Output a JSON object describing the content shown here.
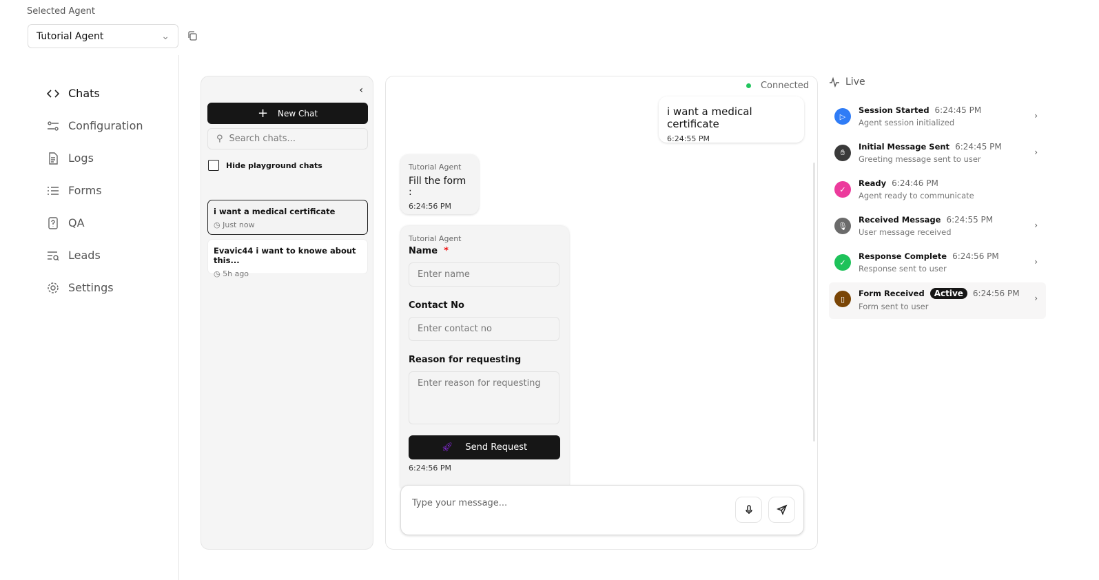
{
  "agent": {
    "label": "Selected Agent",
    "selected": "Tutorial Agent"
  },
  "nav": [
    {
      "label": "Chats",
      "icon": "code-icon"
    },
    {
      "label": "Configuration",
      "icon": "sliders-icon"
    },
    {
      "label": "Logs",
      "icon": "file-icon"
    },
    {
      "label": "Forms",
      "icon": "list-icon"
    },
    {
      "label": "QA",
      "icon": "help-icon"
    },
    {
      "label": "Leads",
      "icon": "filter-search-icon"
    },
    {
      "label": "Settings",
      "icon": "gear-icon"
    }
  ],
  "chat_list": {
    "new_chat": "New Chat",
    "search_placeholder": "Search chats...",
    "hide_label": "Hide playground chats",
    "items": [
      {
        "title": "i want a medical certificate",
        "time": "Just now"
      },
      {
        "title": "Evavic44 i want to knowe about this...",
        "time": "5h ago"
      }
    ]
  },
  "chat": {
    "status": "Connected",
    "user_msg": {
      "text": "i want a medical certificate",
      "time": "6:24:55 PM"
    },
    "agent_msg": {
      "sender": "Tutorial Agent",
      "text": "Fill the form :",
      "time": "6:24:56 PM"
    },
    "form": {
      "sender": "Tutorial Agent",
      "fields": [
        {
          "label": "Name",
          "required": "*",
          "placeholder": "Enter name"
        },
        {
          "label": "Contact No",
          "placeholder": "Enter contact no"
        },
        {
          "label": "Reason for requesting",
          "placeholder": "Enter reason for requesting"
        }
      ],
      "submit": "Send Request",
      "time": "6:24:56 PM"
    },
    "input_placeholder": "Type your message..."
  },
  "live": {
    "title": "Live",
    "events": [
      {
        "title": "Session Started",
        "time": "6:24:45 PM",
        "desc": "Agent session initialized",
        "color": "#2f7cf6"
      },
      {
        "title": "Initial Message Sent",
        "time": "6:24:45 PM",
        "desc": "Greeting message sent to user",
        "color": "#3a3a3a"
      },
      {
        "title": "Ready",
        "time": "6:24:46 PM",
        "desc": "Agent ready to communicate",
        "color": "#ec3b9c"
      },
      {
        "title": "Received Message",
        "time": "6:24:55 PM",
        "desc": "User message received",
        "color": "#6b6b6b"
      },
      {
        "title": "Response Complete",
        "time": "6:24:56 PM",
        "desc": "Response sent to user",
        "color": "#1ec25a"
      },
      {
        "title": "Form Received",
        "badge": "Active",
        "time": "6:24:56 PM",
        "desc": "Form sent to user",
        "color": "#7a4506"
      }
    ]
  }
}
